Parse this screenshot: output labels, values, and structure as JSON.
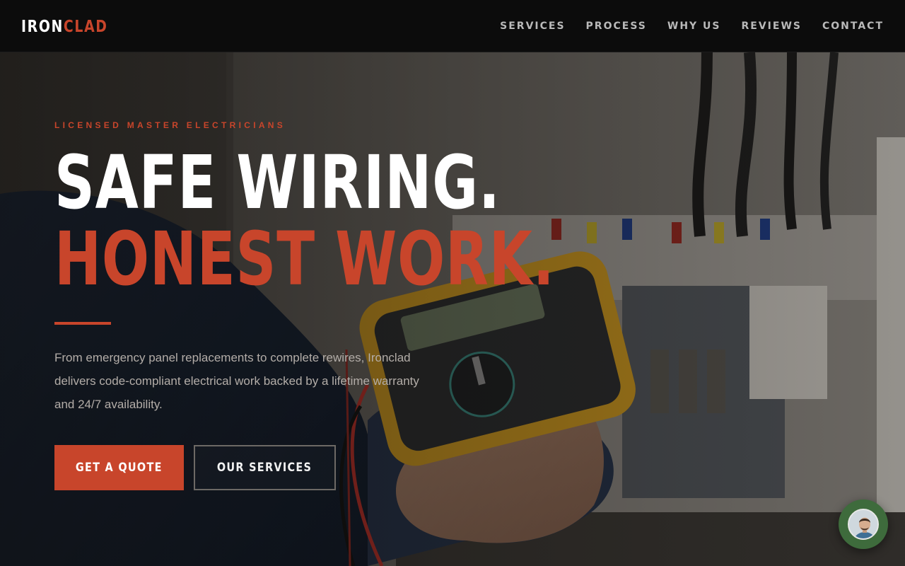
{
  "brand": {
    "name_part1": "IRON",
    "name_part2": "CLAD",
    "accent_color": "#c8452b"
  },
  "nav": {
    "items": [
      {
        "label": "SERVICES"
      },
      {
        "label": "PROCESS"
      },
      {
        "label": "WHY US"
      },
      {
        "label": "REVIEWS"
      },
      {
        "label": "CONTACT"
      }
    ]
  },
  "hero": {
    "eyebrow": "LICENSED MASTER ELECTRICIANS",
    "headline_line1": "SAFE WIRING.",
    "headline_line2": "HONEST WORK.",
    "lede": "From emergency panel replacements to complete rewires, Ironclad delivers code-compliant electrical work backed by a lifetime warranty and 24/7 availability.",
    "primary_cta": "GET A QUOTE",
    "secondary_cta": "OUR SERVICES"
  },
  "chat_widget": {
    "icon": "chat-avatar-icon",
    "color": "#3e6b3c"
  },
  "colors": {
    "background": "#0c0c0c",
    "nav_text": "#b9b9b9",
    "body_text": "#b3ada8"
  }
}
